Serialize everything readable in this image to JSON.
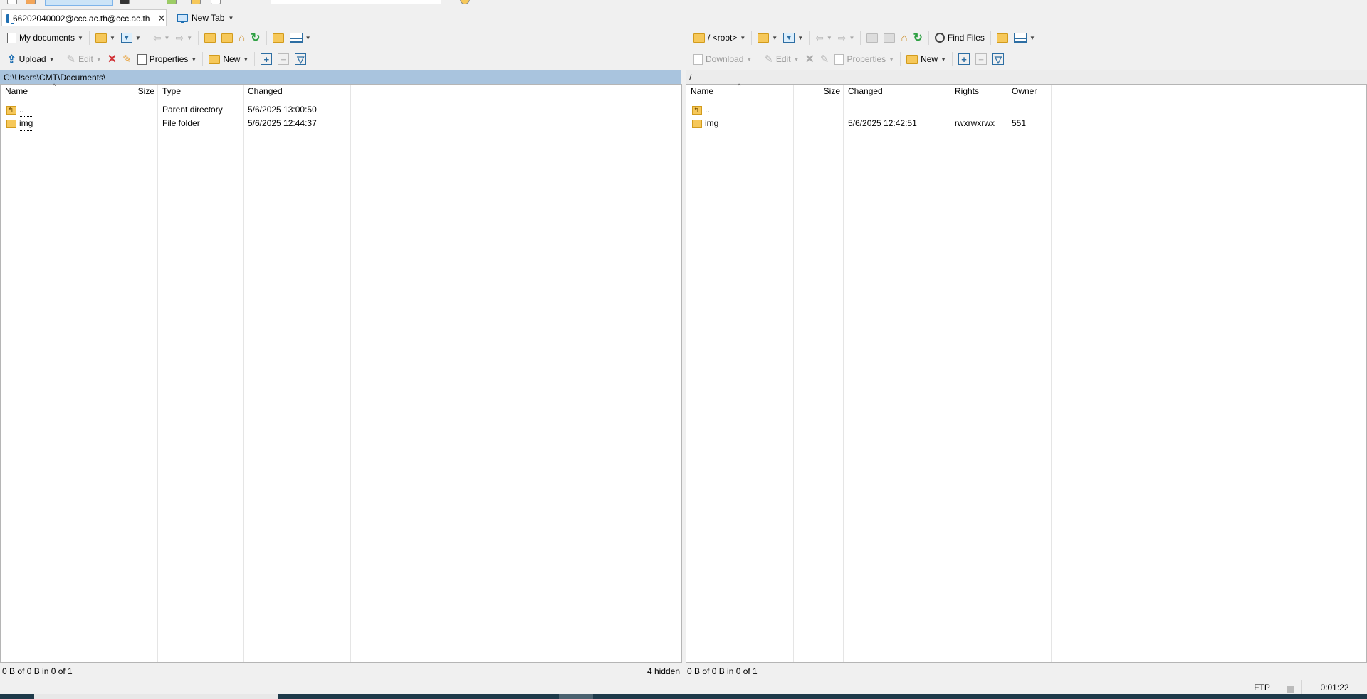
{
  "session_tabs": [
    {
      "label": "66202040002@ccc.ac.th@ccc.ac.th",
      "active": true
    },
    {
      "label": "New Tab",
      "active": false
    }
  ],
  "local": {
    "location_label": "My documents",
    "toolbar": {
      "upload": "Upload",
      "edit": "Edit",
      "properties": "Properties",
      "new": "New"
    },
    "path": "C:\\Users\\CMT\\Documents\\",
    "columns": [
      "Name",
      "Size",
      "Type",
      "Changed"
    ],
    "rows": [
      {
        "name": "..",
        "size": "",
        "type": "Parent directory",
        "changed": "5/6/2025 13:00:50"
      },
      {
        "name": "img",
        "size": "",
        "type": "File folder",
        "changed": "5/6/2025 12:44:37"
      }
    ],
    "status": "0 B of 0 B in 0 of 1",
    "hidden": "4 hidden"
  },
  "remote": {
    "location_label": "/ <root>",
    "find_files": "Find Files",
    "toolbar": {
      "download": "Download",
      "edit": "Edit",
      "properties": "Properties",
      "new": "New"
    },
    "path": "/",
    "columns": [
      "Name",
      "Size",
      "Changed",
      "Rights",
      "Owner"
    ],
    "rows": [
      {
        "name": "..",
        "size": "",
        "changed": "",
        "rights": "",
        "owner": ""
      },
      {
        "name": "img",
        "size": "",
        "changed": "5/6/2025 12:42:51",
        "rights": "rwxrwxrwx",
        "owner": "551"
      }
    ],
    "status": "0 B of 0 B in 0 of 1"
  },
  "statusbar": {
    "protocol": "FTP",
    "elapsed": "0:01:22"
  }
}
